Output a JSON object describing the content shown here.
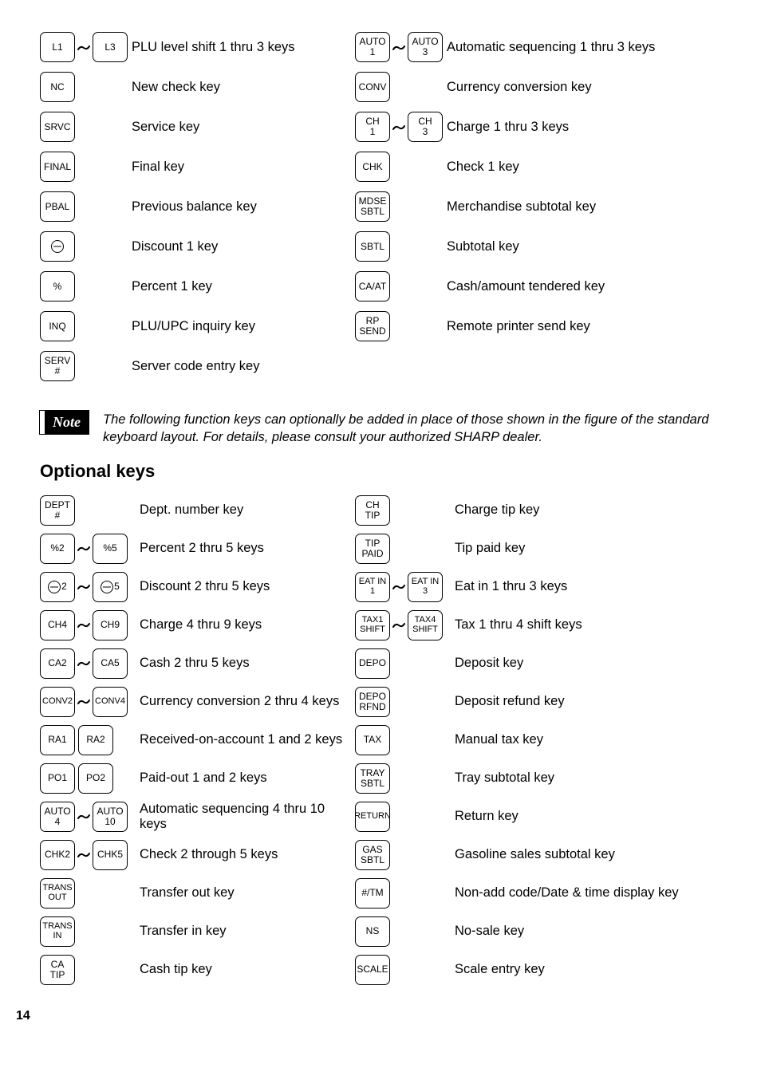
{
  "standard_keys_left": [
    {
      "keys": [
        {
          "l1": "L1"
        },
        {
          "l1": "L3"
        }
      ],
      "range": true,
      "desc": "PLU level shift 1 thru 3 keys"
    },
    {
      "keys": [
        {
          "l1": "NC"
        }
      ],
      "desc": "New check key"
    },
    {
      "keys": [
        {
          "l1": "SRVC"
        }
      ],
      "desc": "Service key"
    },
    {
      "keys": [
        {
          "l1": "FINAL"
        }
      ],
      "desc": "Final key"
    },
    {
      "keys": [
        {
          "l1": "PBAL"
        }
      ],
      "desc": "Previous balance key"
    },
    {
      "keys": [
        {
          "icon": "circle-minus"
        }
      ],
      "desc": "Discount 1 key"
    },
    {
      "keys": [
        {
          "l1": "%"
        }
      ],
      "desc": "Percent 1 key"
    },
    {
      "keys": [
        {
          "l1": "INQ"
        }
      ],
      "desc": "PLU/UPC inquiry key"
    },
    {
      "keys": [
        {
          "l1": "SERV",
          "l2": "#"
        }
      ],
      "desc": "Server code entry key"
    }
  ],
  "standard_keys_right": [
    {
      "keys": [
        {
          "l1": "AUTO",
          "l2": "1"
        },
        {
          "l1": "AUTO",
          "l2": "3"
        }
      ],
      "range": true,
      "desc": "Automatic sequencing 1 thru 3 keys"
    },
    {
      "keys": [
        {
          "l1": "CONV"
        }
      ],
      "desc": "Currency conversion key"
    },
    {
      "keys": [
        {
          "l1": "CH",
          "l2": "1"
        },
        {
          "l1": "CH",
          "l2": "3"
        }
      ],
      "range": true,
      "desc": "Charge 1 thru 3 keys"
    },
    {
      "keys": [
        {
          "l1": "CHK"
        }
      ],
      "desc": "Check 1 key"
    },
    {
      "keys": [
        {
          "l1": "MDSE",
          "l2": "SBTL"
        }
      ],
      "desc": "Merchandise subtotal key"
    },
    {
      "keys": [
        {
          "l1": "SBTL"
        }
      ],
      "desc": "Subtotal key"
    },
    {
      "keys": [
        {
          "l1": "CA/AT"
        }
      ],
      "desc": "Cash/amount tendered key"
    },
    {
      "keys": [
        {
          "l1": "RP",
          "l2": "SEND"
        }
      ],
      "desc": "Remote printer send key"
    }
  ],
  "note_label": "Note",
  "note_text": "The following function keys can optionally be added in place of those shown in the figure of the standard keyboard layout. For details, please consult your authorized SHARP dealer.",
  "optional_heading": "Optional keys",
  "optional_left": [
    {
      "keys": [
        {
          "l1": "DEPT",
          "l2": "#"
        }
      ],
      "desc": "Dept. number key"
    },
    {
      "keys": [
        {
          "l1": "%2"
        },
        {
          "l1": "%5"
        }
      ],
      "range": true,
      "desc": "Percent 2 thru 5 keys"
    },
    {
      "keys": [
        {
          "icon": "circle-minus",
          "suffix": "2"
        },
        {
          "icon": "circle-minus",
          "suffix": "5"
        }
      ],
      "range": true,
      "desc": "Discount 2 thru 5 keys"
    },
    {
      "keys": [
        {
          "l1": "CH4"
        },
        {
          "l1": "CH9"
        }
      ],
      "range": true,
      "desc": "Charge 4 thru 9 keys"
    },
    {
      "keys": [
        {
          "l1": "CA2"
        },
        {
          "l1": "CA5"
        }
      ],
      "range": true,
      "desc": "Cash 2 thru 5 keys"
    },
    {
      "keys": [
        {
          "l1": "CONV2"
        },
        {
          "l1": "CONV4"
        }
      ],
      "range": true,
      "small": true,
      "desc": "Currency conversion 2 thru 4 keys"
    },
    {
      "keys": [
        {
          "l1": "RA1"
        },
        {
          "l1": "RA2"
        }
      ],
      "pair": true,
      "desc": "Received-on-account 1 and 2 keys"
    },
    {
      "keys": [
        {
          "l1": "PO1"
        },
        {
          "l1": "PO2"
        }
      ],
      "pair": true,
      "desc": "Paid-out 1 and 2 keys"
    },
    {
      "keys": [
        {
          "l1": "AUTO",
          "l2": "4"
        },
        {
          "l1": "AUTO",
          "l2": "10"
        }
      ],
      "range": true,
      "desc": "Automatic sequencing 4 thru 10 keys"
    },
    {
      "keys": [
        {
          "l1": "CHK2"
        },
        {
          "l1": "CHK5"
        }
      ],
      "range": true,
      "desc": "Check 2 through 5 keys"
    },
    {
      "keys": [
        {
          "l1": "TRANS",
          "l2": "OUT"
        }
      ],
      "small": true,
      "desc": "Transfer out key"
    },
    {
      "keys": [
        {
          "l1": "TRANS",
          "l2": "IN"
        }
      ],
      "small": true,
      "desc": "Transfer in key"
    },
    {
      "keys": [
        {
          "l1": "CA",
          "l2": "TIP"
        }
      ],
      "desc": "Cash tip key"
    }
  ],
  "optional_right": [
    {
      "keys": [
        {
          "l1": "CH",
          "l2": "TIP"
        }
      ],
      "desc": "Charge tip key"
    },
    {
      "keys": [
        {
          "l1": "TIP",
          "l2": "PAID"
        }
      ],
      "desc": "Tip paid key"
    },
    {
      "keys": [
        {
          "l1": "EAT IN",
          "l2": "1"
        },
        {
          "l1": "EAT IN",
          "l2": "3"
        }
      ],
      "range": true,
      "small": true,
      "desc": "Eat in 1 thru 3 keys"
    },
    {
      "keys": [
        {
          "l1": "TAX1",
          "l2": "SHIFT"
        },
        {
          "l1": "TAX4",
          "l2": "SHIFT"
        }
      ],
      "range": true,
      "small": true,
      "desc": "Tax 1 thru 4 shift keys"
    },
    {
      "keys": [
        {
          "l1": "DEPO"
        }
      ],
      "desc": "Deposit key"
    },
    {
      "keys": [
        {
          "l1": "DEPO",
          "l2": "RFND"
        }
      ],
      "desc": "Deposit refund key"
    },
    {
      "keys": [
        {
          "l1": "TAX"
        }
      ],
      "desc": "Manual tax key"
    },
    {
      "keys": [
        {
          "l1": "TRAY",
          "l2": "SBTL"
        }
      ],
      "desc": "Tray subtotal key"
    },
    {
      "keys": [
        {
          "l1": "RETURN"
        }
      ],
      "small": true,
      "desc": "Return key"
    },
    {
      "keys": [
        {
          "l1": "GAS",
          "l2": "SBTL"
        }
      ],
      "desc": "Gasoline sales subtotal key"
    },
    {
      "keys": [
        {
          "l1": "#/TM"
        }
      ],
      "desc": "Non-add code/Date & time display key"
    },
    {
      "keys": [
        {
          "l1": "NS"
        }
      ],
      "desc": "No-sale key"
    },
    {
      "keys": [
        {
          "l1": "SCALE"
        }
      ],
      "desc": "Scale entry key"
    }
  ],
  "page_number": "14"
}
